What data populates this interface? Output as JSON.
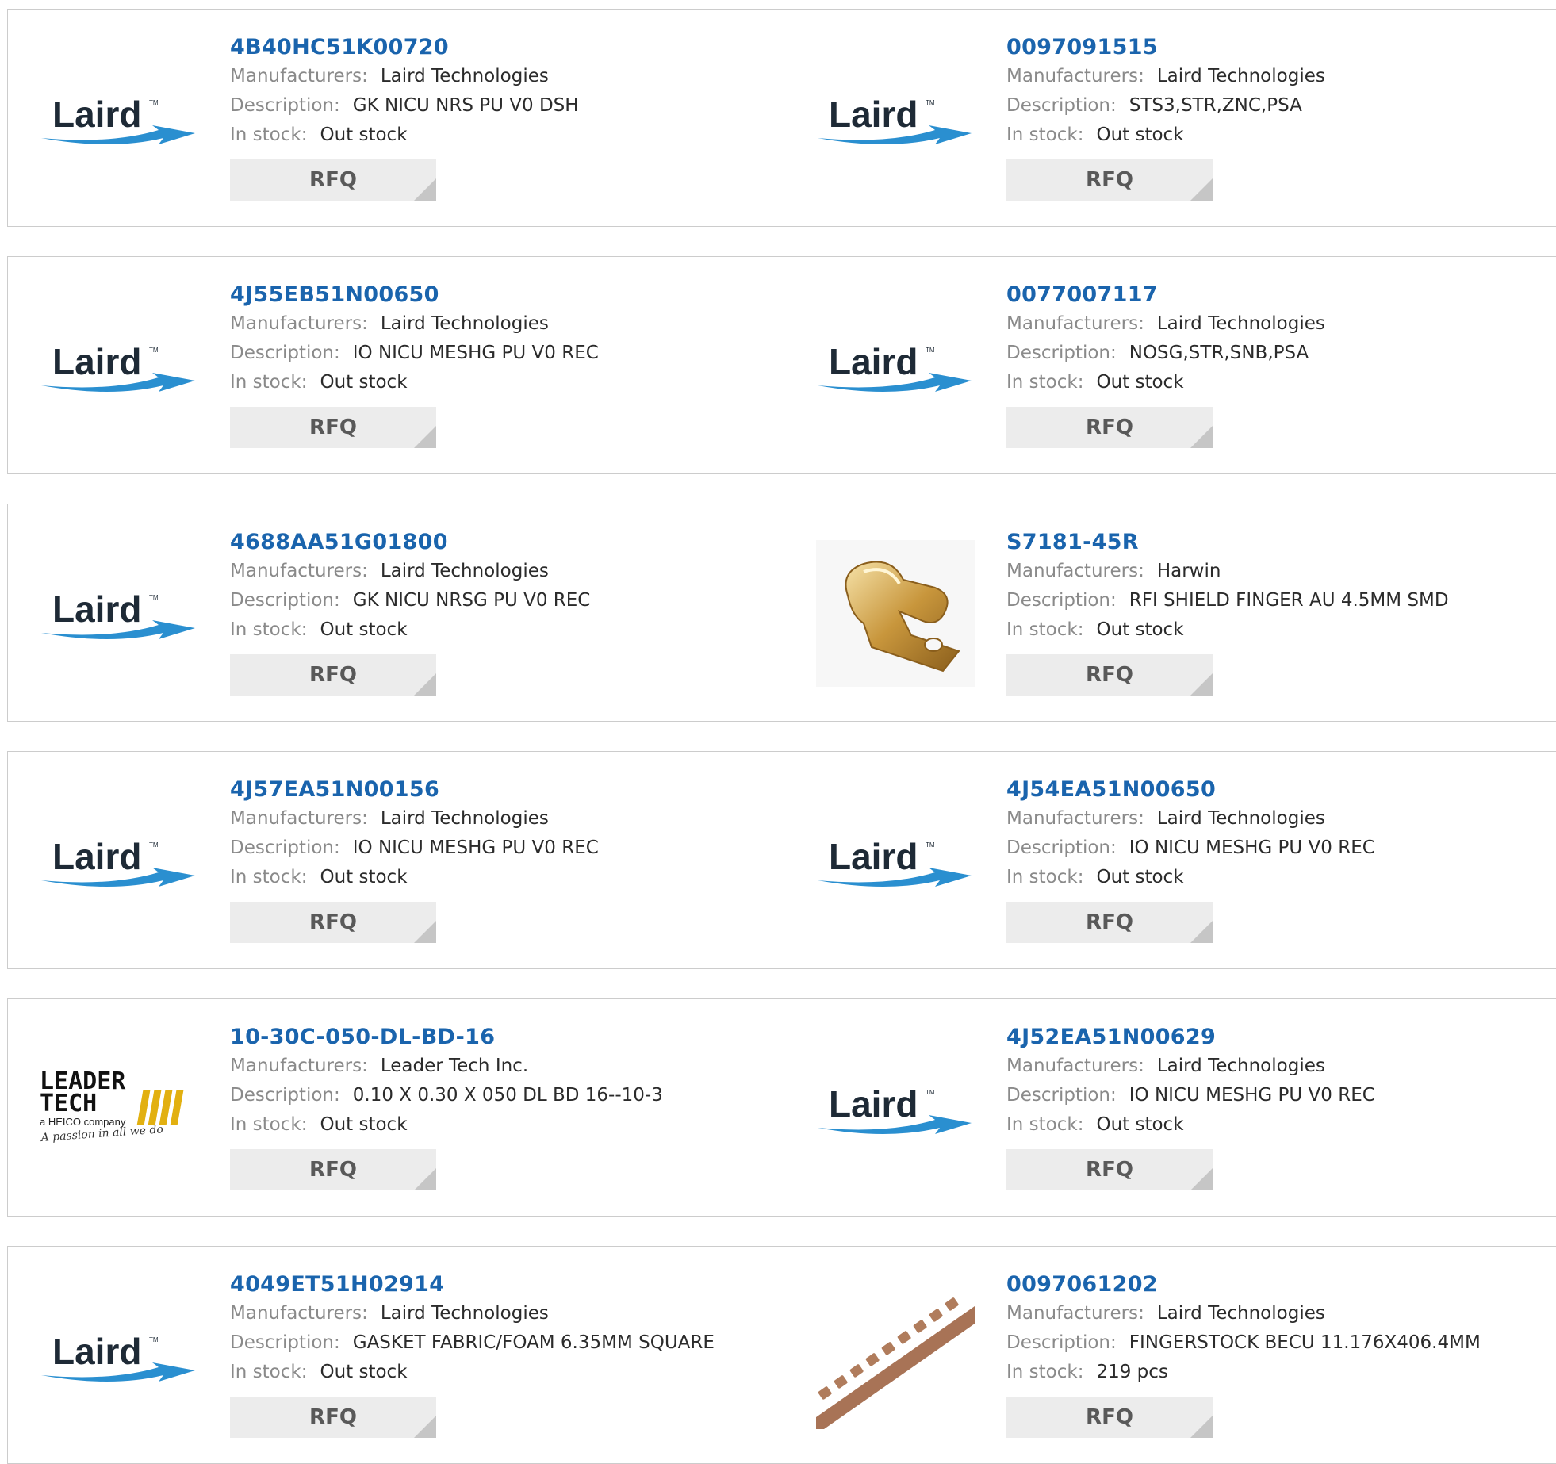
{
  "labels": {
    "manufacturers": "Manufacturers:",
    "description": "Description:",
    "in_stock": "In stock:",
    "rfq": "RFQ"
  },
  "colors": {
    "part_link": "#1a64ad",
    "label": "#8a8a8a",
    "button_bg": "#ececec",
    "laird_blue": "#2a8fd0"
  },
  "products": [
    {
      "part": "4B40HC51K00720",
      "manufacturer": "Laird Technologies",
      "description": "GK NICU NRS PU V0 DSH",
      "stock": "Out stock",
      "image": "laird-logo",
      "logo_text": "Laird"
    },
    {
      "part": "0097091515",
      "manufacturer": "Laird Technologies",
      "description": "STS3,STR,ZNC,PSA",
      "stock": "Out stock",
      "image": "laird-logo",
      "logo_text": "Laird"
    },
    {
      "part": "4J55EB51N00650",
      "manufacturer": "Laird Technologies",
      "description": "IO NICU MESHG PU V0 REC",
      "stock": "Out stock",
      "image": "laird-logo",
      "logo_text": "Laird"
    },
    {
      "part": "0077007117",
      "manufacturer": "Laird Technologies",
      "description": "NOSG,STR,SNB,PSA",
      "stock": "Out stock",
      "image": "laird-logo",
      "logo_text": "Laird"
    },
    {
      "part": "4688AA51G01800",
      "manufacturer": "Laird Technologies",
      "description": "GK NICU NRSG PU V0 REC",
      "stock": "Out stock",
      "image": "laird-logo",
      "logo_text": "Laird"
    },
    {
      "part": "S7181-45R",
      "manufacturer": "Harwin",
      "description": "RFI SHIELD FINGER AU 4.5MM SMD",
      "stock": "Out stock",
      "image": "shield-finger-photo"
    },
    {
      "part": "4J57EA51N00156",
      "manufacturer": "Laird Technologies",
      "description": "IO NICU MESHG PU V0 REC",
      "stock": "Out stock",
      "image": "laird-logo",
      "logo_text": "Laird"
    },
    {
      "part": "4J54EA51N00650",
      "manufacturer": "Laird Technologies",
      "description": "IO NICU MESHG PU V0 REC",
      "stock": "Out stock",
      "image": "laird-logo",
      "logo_text": "Laird"
    },
    {
      "part": "10-30C-050-DL-BD-16",
      "manufacturer": "Leader Tech Inc.",
      "description": "0.10 X 0.30 X 050 DL BD 16--10-3",
      "stock": "Out stock",
      "image": "leader-tech-logo",
      "logo_text": [
        "LEADER",
        "TECH",
        "a HEICO company",
        "A passion in all we do"
      ]
    },
    {
      "part": "4J52EA51N00629",
      "manufacturer": "Laird Technologies",
      "description": "IO NICU MESHG PU V0 REC",
      "stock": "Out stock",
      "image": "laird-logo",
      "logo_text": "Laird"
    },
    {
      "part": "4049ET51H02914",
      "manufacturer": "Laird Technologies",
      "description": "GASKET FABRIC/FOAM 6.35MM SQUARE",
      "stock": "Out stock",
      "image": "laird-logo",
      "logo_text": "Laird"
    },
    {
      "part": "0097061202",
      "manufacturer": "Laird Technologies",
      "description": "FINGERSTOCK BECU 11.176X406.4MM",
      "stock": "219 pcs",
      "image": "fingerstock-photo"
    }
  ]
}
